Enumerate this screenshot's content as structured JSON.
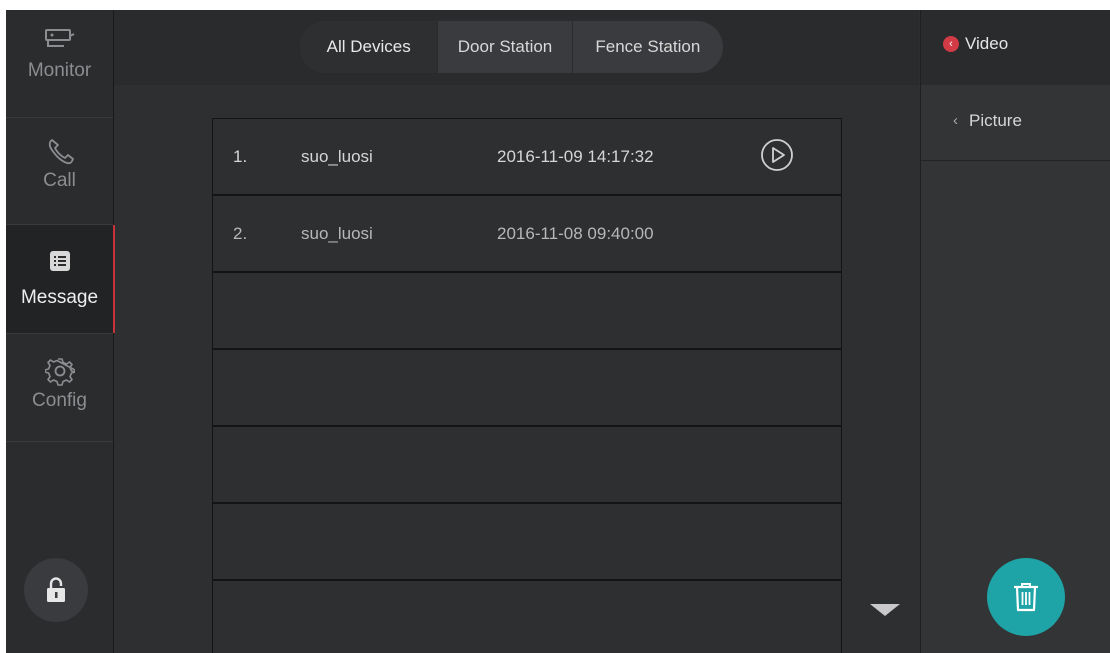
{
  "sidebar": {
    "items": [
      {
        "label": "Monitor",
        "icon": "camera-icon"
      },
      {
        "label": "Call",
        "icon": "phone-icon"
      },
      {
        "label": "Message",
        "icon": "message-list-icon",
        "active": true
      },
      {
        "label": "Config",
        "icon": "gear-icon"
      }
    ],
    "lock_icon": "lock-icon"
  },
  "tabs": [
    {
      "label": "All Devices",
      "active": true
    },
    {
      "label": "Door Station",
      "active": false
    },
    {
      "label": "Fence Station",
      "active": false
    }
  ],
  "messages": [
    {
      "index": "1.",
      "name": "suo_luosi",
      "time": "2016-11-09 14:17:32",
      "has_play": true
    },
    {
      "index": "2.",
      "name": "suo_luosi",
      "time": "2016-11-08 09:40:00",
      "has_play": false
    }
  ],
  "right_panel": {
    "video_label": "Video",
    "picture_label": "Picture",
    "delete_icon": "trash-icon"
  },
  "colors": {
    "accent_red": "#d23b45",
    "teal": "#1ea4a6",
    "panel_bg": "#2e2f31"
  }
}
